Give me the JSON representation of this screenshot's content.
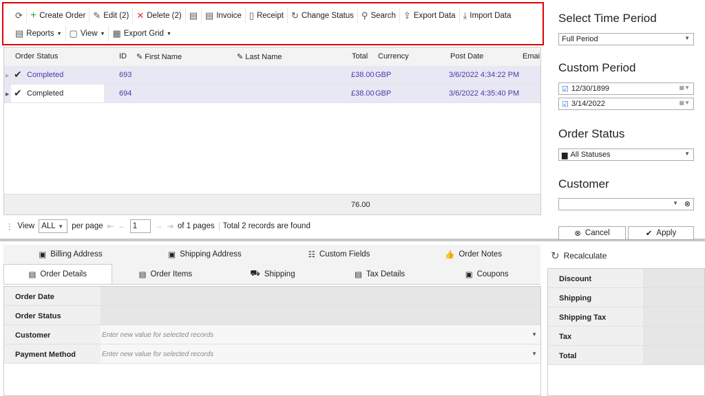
{
  "toolbar": {
    "row1": [
      {
        "icon": "refresh-icon",
        "label": ""
      },
      {
        "icon": "plus-icon",
        "label": "Create Order"
      },
      {
        "icon": "pencil-icon",
        "label": "Edit (2)"
      },
      {
        "icon": "x-icon",
        "label": "Delete (2)"
      },
      {
        "icon": "clipboard-view-icon",
        "label": ""
      },
      {
        "icon": "invoice-icon",
        "label": "Invoice"
      },
      {
        "icon": "receipt-icon",
        "label": "Receipt"
      },
      {
        "icon": "change-status-icon",
        "label": "Change Status"
      },
      {
        "icon": "search-icon",
        "label": "Search"
      },
      {
        "icon": "export-icon",
        "label": "Export Data"
      },
      {
        "icon": "import-icon",
        "label": "Import Data"
      }
    ],
    "row2": [
      {
        "icon": "reports-icon",
        "label": "Reports"
      },
      {
        "icon": "view-icon",
        "label": "View"
      },
      {
        "icon": "export-grid-icon",
        "label": "Export Grid"
      }
    ]
  },
  "grid": {
    "columns": [
      "Order Status",
      "ID",
      "First Name",
      "Last Name",
      "Total",
      "Currency",
      "Post Date",
      "Emai"
    ],
    "rows": [
      {
        "status": "Completed",
        "id": "693",
        "total": "£38.00",
        "currency": "GBP",
        "date": "3/6/2022 4:34:22 PM"
      },
      {
        "status": "Completed",
        "id": "694",
        "total": "£38.00",
        "currency": "GBP",
        "date": "3/6/2022 4:35:40 PM"
      }
    ],
    "footer_total": "76.00"
  },
  "pager": {
    "view": "View",
    "per_page_value": "ALL",
    "per_page": "per page",
    "page": "1",
    "of_pages": "of 1 pages",
    "records": "Total 2 records are found"
  },
  "tabs": {
    "row1": [
      "Billing Address",
      "Shipping Address",
      "Custom Fields",
      "Order Notes"
    ],
    "row2": [
      "Order Details",
      "Order Items",
      "Shipping",
      "Tax Details",
      "Coupons"
    ],
    "selected": "Order Details"
  },
  "details": {
    "rows": [
      {
        "label": "Order Date",
        "value": ""
      },
      {
        "label": "Order Status",
        "value": ""
      },
      {
        "label": "Customer",
        "value": "Enter new value for selected records"
      },
      {
        "label": "Payment Method",
        "value": "Enter new value for selected records"
      }
    ]
  },
  "side": {
    "time_title": "Select Time Period",
    "time_value": "Full Period",
    "custom_title": "Custom Period",
    "date_from": "12/30/1899",
    "date_to": "3/14/2022",
    "status_title": "Order Status",
    "status_value": "All Statuses",
    "customer_title": "Customer",
    "customer_value": "",
    "cancel": "Cancel",
    "apply": "Apply"
  },
  "totals": {
    "recalculate": "Recalculate",
    "rows": [
      "Discount",
      "Shipping",
      "Shipping Tax",
      "Tax",
      "Total"
    ]
  }
}
